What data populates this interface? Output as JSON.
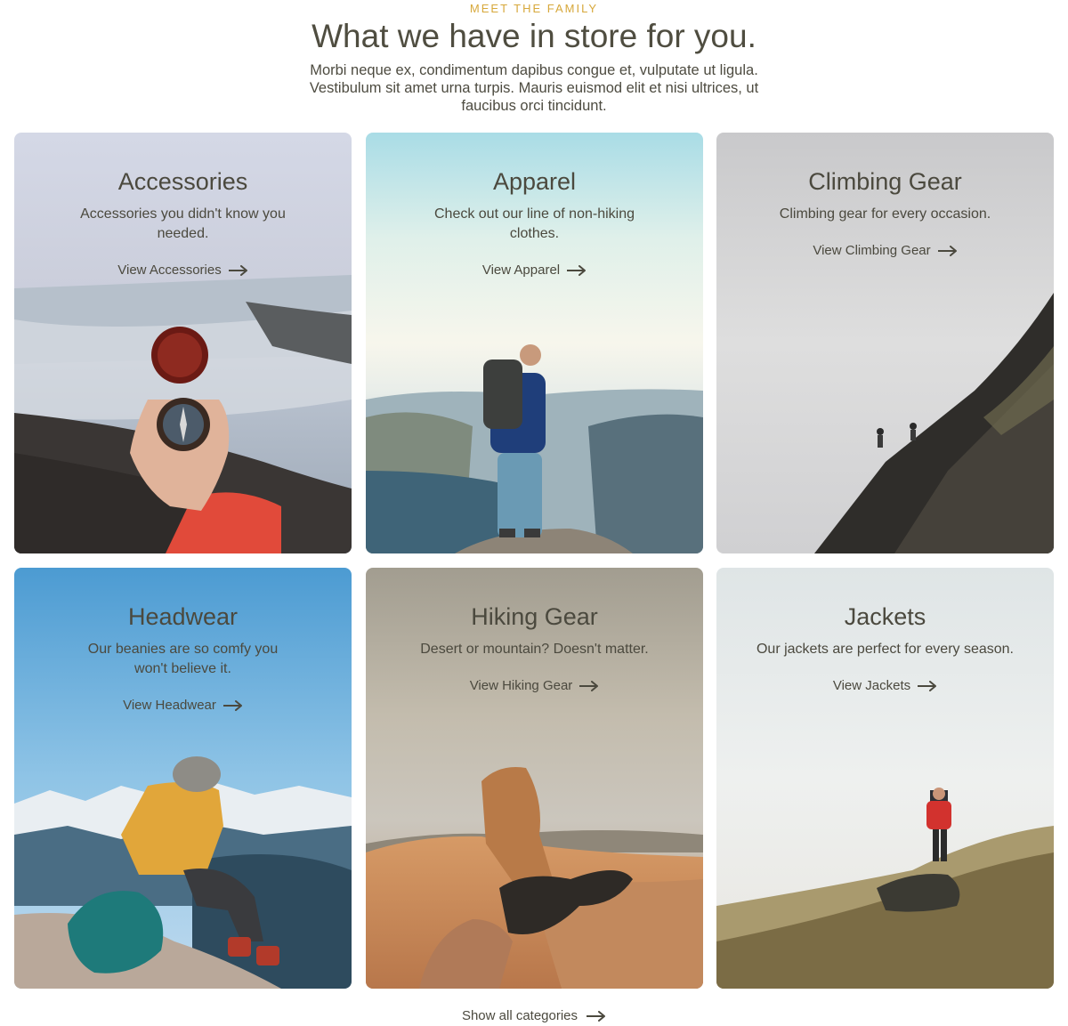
{
  "section": {
    "eyebrow": "MEET THE FAMILY",
    "headline": "What we have in store for you.",
    "intro": "Morbi neque ex, condimentum dapibus congue et, vulputate ut ligula. Vestibulum sit amet urna turpis. Mauris euismod elit et nisi ultrices, ut faucibus orci tincidunt."
  },
  "cards": [
    {
      "title": "Accessories",
      "description": "Accessories you didn't know you needed.",
      "link": "View Accessories"
    },
    {
      "title": "Apparel",
      "description": "Check out our line of non-hiking clothes.",
      "link": "View Apparel"
    },
    {
      "title": "Climbing Gear",
      "description": "Climbing gear for every occasion.",
      "link": "View Climbing Gear"
    },
    {
      "title": "Headwear",
      "description": "Our beanies are so comfy you won't believe it.",
      "link": "View Headwear"
    },
    {
      "title": "Hiking Gear",
      "description": "Desert or mountain? Doesn't matter.",
      "link": "View Hiking Gear"
    },
    {
      "title": "Jackets",
      "description": "Our jackets are perfect for every season.",
      "link": "View Jackets"
    }
  ],
  "footer": {
    "show_all": "Show all categories"
  },
  "icons": {
    "link_arrow": "arrow-right-icon"
  },
  "colors": {
    "eyebrow": "#d7a83b",
    "heading": "#4f4d40",
    "body_text": "#4b493e"
  }
}
